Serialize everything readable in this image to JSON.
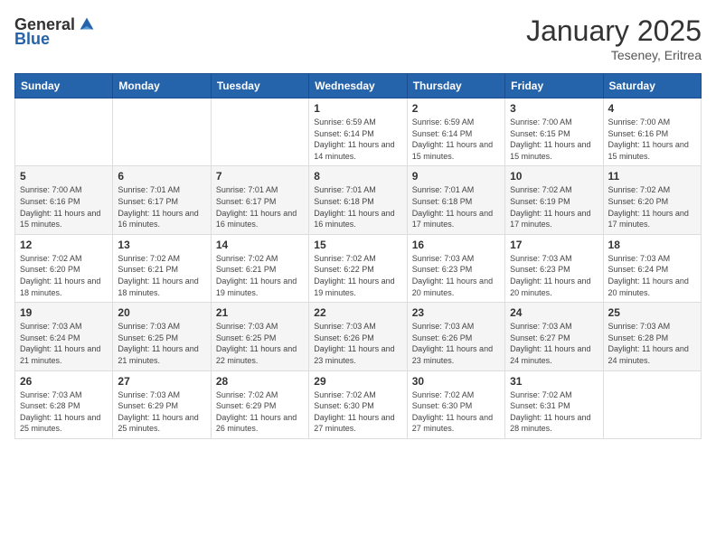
{
  "logo": {
    "general": "General",
    "blue": "Blue"
  },
  "header": {
    "month": "January 2025",
    "location": "Teseney, Eritrea"
  },
  "weekdays": [
    "Sunday",
    "Monday",
    "Tuesday",
    "Wednesday",
    "Thursday",
    "Friday",
    "Saturday"
  ],
  "weeks": [
    [
      {
        "day": "",
        "info": ""
      },
      {
        "day": "",
        "info": ""
      },
      {
        "day": "",
        "info": ""
      },
      {
        "day": "1",
        "info": "Sunrise: 6:59 AM\nSunset: 6:14 PM\nDaylight: 11 hours and 14 minutes."
      },
      {
        "day": "2",
        "info": "Sunrise: 6:59 AM\nSunset: 6:14 PM\nDaylight: 11 hours and 15 minutes."
      },
      {
        "day": "3",
        "info": "Sunrise: 7:00 AM\nSunset: 6:15 PM\nDaylight: 11 hours and 15 minutes."
      },
      {
        "day": "4",
        "info": "Sunrise: 7:00 AM\nSunset: 6:16 PM\nDaylight: 11 hours and 15 minutes."
      }
    ],
    [
      {
        "day": "5",
        "info": "Sunrise: 7:00 AM\nSunset: 6:16 PM\nDaylight: 11 hours and 15 minutes."
      },
      {
        "day": "6",
        "info": "Sunrise: 7:01 AM\nSunset: 6:17 PM\nDaylight: 11 hours and 16 minutes."
      },
      {
        "day": "7",
        "info": "Sunrise: 7:01 AM\nSunset: 6:17 PM\nDaylight: 11 hours and 16 minutes."
      },
      {
        "day": "8",
        "info": "Sunrise: 7:01 AM\nSunset: 6:18 PM\nDaylight: 11 hours and 16 minutes."
      },
      {
        "day": "9",
        "info": "Sunrise: 7:01 AM\nSunset: 6:18 PM\nDaylight: 11 hours and 17 minutes."
      },
      {
        "day": "10",
        "info": "Sunrise: 7:02 AM\nSunset: 6:19 PM\nDaylight: 11 hours and 17 minutes."
      },
      {
        "day": "11",
        "info": "Sunrise: 7:02 AM\nSunset: 6:20 PM\nDaylight: 11 hours and 17 minutes."
      }
    ],
    [
      {
        "day": "12",
        "info": "Sunrise: 7:02 AM\nSunset: 6:20 PM\nDaylight: 11 hours and 18 minutes."
      },
      {
        "day": "13",
        "info": "Sunrise: 7:02 AM\nSunset: 6:21 PM\nDaylight: 11 hours and 18 minutes."
      },
      {
        "day": "14",
        "info": "Sunrise: 7:02 AM\nSunset: 6:21 PM\nDaylight: 11 hours and 19 minutes."
      },
      {
        "day": "15",
        "info": "Sunrise: 7:02 AM\nSunset: 6:22 PM\nDaylight: 11 hours and 19 minutes."
      },
      {
        "day": "16",
        "info": "Sunrise: 7:03 AM\nSunset: 6:23 PM\nDaylight: 11 hours and 20 minutes."
      },
      {
        "day": "17",
        "info": "Sunrise: 7:03 AM\nSunset: 6:23 PM\nDaylight: 11 hours and 20 minutes."
      },
      {
        "day": "18",
        "info": "Sunrise: 7:03 AM\nSunset: 6:24 PM\nDaylight: 11 hours and 20 minutes."
      }
    ],
    [
      {
        "day": "19",
        "info": "Sunrise: 7:03 AM\nSunset: 6:24 PM\nDaylight: 11 hours and 21 minutes."
      },
      {
        "day": "20",
        "info": "Sunrise: 7:03 AM\nSunset: 6:25 PM\nDaylight: 11 hours and 21 minutes."
      },
      {
        "day": "21",
        "info": "Sunrise: 7:03 AM\nSunset: 6:25 PM\nDaylight: 11 hours and 22 minutes."
      },
      {
        "day": "22",
        "info": "Sunrise: 7:03 AM\nSunset: 6:26 PM\nDaylight: 11 hours and 23 minutes."
      },
      {
        "day": "23",
        "info": "Sunrise: 7:03 AM\nSunset: 6:26 PM\nDaylight: 11 hours and 23 minutes."
      },
      {
        "day": "24",
        "info": "Sunrise: 7:03 AM\nSunset: 6:27 PM\nDaylight: 11 hours and 24 minutes."
      },
      {
        "day": "25",
        "info": "Sunrise: 7:03 AM\nSunset: 6:28 PM\nDaylight: 11 hours and 24 minutes."
      }
    ],
    [
      {
        "day": "26",
        "info": "Sunrise: 7:03 AM\nSunset: 6:28 PM\nDaylight: 11 hours and 25 minutes."
      },
      {
        "day": "27",
        "info": "Sunrise: 7:03 AM\nSunset: 6:29 PM\nDaylight: 11 hours and 25 minutes."
      },
      {
        "day": "28",
        "info": "Sunrise: 7:02 AM\nSunset: 6:29 PM\nDaylight: 11 hours and 26 minutes."
      },
      {
        "day": "29",
        "info": "Sunrise: 7:02 AM\nSunset: 6:30 PM\nDaylight: 11 hours and 27 minutes."
      },
      {
        "day": "30",
        "info": "Sunrise: 7:02 AM\nSunset: 6:30 PM\nDaylight: 11 hours and 27 minutes."
      },
      {
        "day": "31",
        "info": "Sunrise: 7:02 AM\nSunset: 6:31 PM\nDaylight: 11 hours and 28 minutes."
      },
      {
        "day": "",
        "info": ""
      }
    ]
  ]
}
